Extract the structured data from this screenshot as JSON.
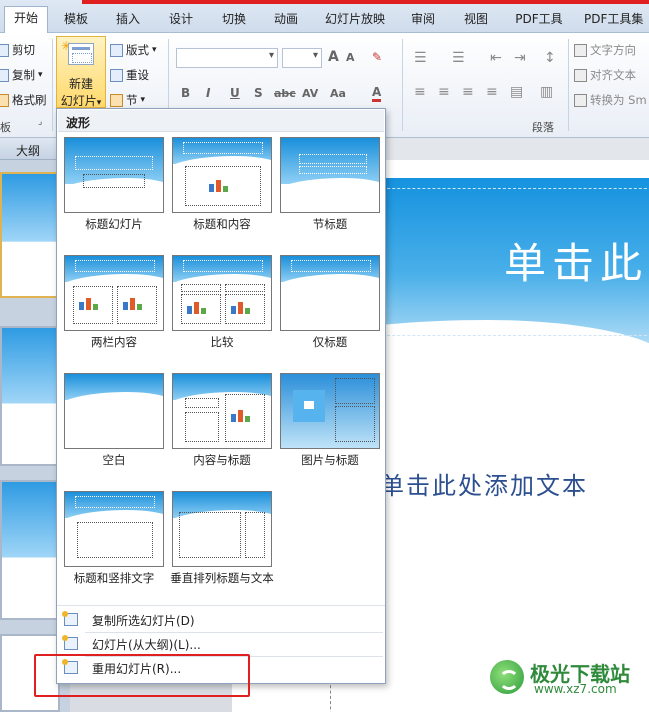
{
  "tabs": [
    {
      "label": "开始",
      "active": true
    },
    {
      "label": "模板"
    },
    {
      "label": "插入"
    },
    {
      "label": "设计"
    },
    {
      "label": "切换"
    },
    {
      "label": "动画"
    },
    {
      "label": "幻灯片放映"
    },
    {
      "label": "审阅"
    },
    {
      "label": "视图"
    },
    {
      "label": "PDF工具"
    },
    {
      "label": "PDF工具集"
    }
  ],
  "clipboard": {
    "cut": "剪切",
    "copy": "复制",
    "format_painter": "格式刷",
    "group_label": "板"
  },
  "slides_group": {
    "new_slide_line1": "新建",
    "new_slide_line2": "幻灯片",
    "layout": "版式",
    "reset": "重设",
    "section": "节"
  },
  "font_group": {
    "bold": "B",
    "italic": "I",
    "underline": "U",
    "shadow": "S",
    "strike": "abc",
    "spacing": "AV",
    "case": "Aa",
    "color": "A",
    "grow": "A",
    "shrink": "A"
  },
  "paragraph_group": {
    "text_direction": "文字方向",
    "align_text": "对齐文本",
    "convert_smartart": "转换为 Sm",
    "group_label": "段落"
  },
  "outline_pane": {
    "header": "大纲"
  },
  "gallery": {
    "theme_name": "波形",
    "layouts": [
      {
        "name": "标题幻灯片"
      },
      {
        "name": "标题和内容"
      },
      {
        "name": "节标题"
      },
      {
        "name": "两栏内容"
      },
      {
        "name": "比较"
      },
      {
        "name": "仅标题"
      },
      {
        "name": "空白"
      },
      {
        "name": "内容与标题"
      },
      {
        "name": "图片与标题"
      },
      {
        "name": "标题和竖排文字"
      },
      {
        "name": "垂直排列标题与文本"
      }
    ],
    "menu_items": [
      {
        "label": "复制所选幻灯片(D)"
      },
      {
        "label": "幻灯片(从大纲)(L)..."
      },
      {
        "label": "重用幻灯片(R)..."
      }
    ]
  },
  "slide": {
    "title_placeholder": "单击此",
    "subtitle_placeholder": "单击此处添加文本"
  },
  "watermark": {
    "title": "极光下载站",
    "url": "www.xz7.com"
  },
  "colors": {
    "highlight_box": "#e02020",
    "slide_blue": "#1592df",
    "accent_tab": "#ffffff"
  }
}
